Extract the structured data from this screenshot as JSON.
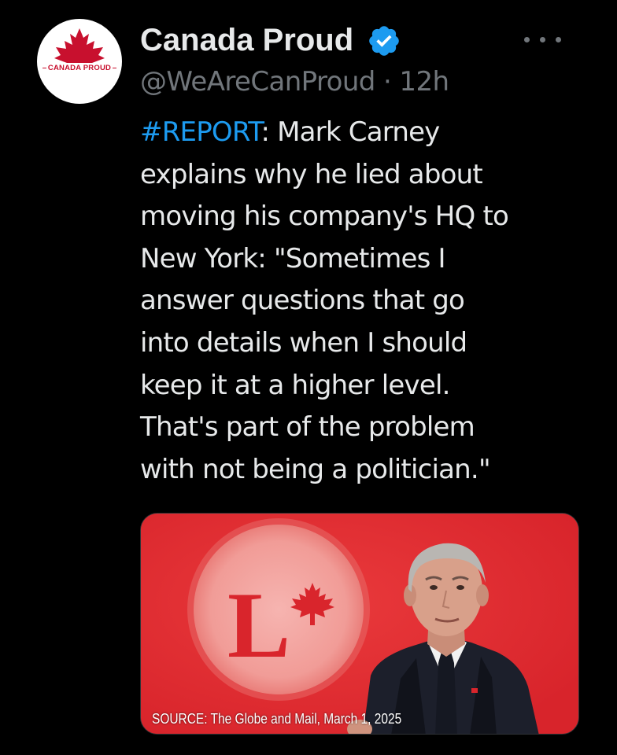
{
  "account": {
    "display_name": "Canada Proud",
    "verified": true,
    "handle": "@WeAreCanProud",
    "separator": "·",
    "time": "12h",
    "avatar_text": "CANADA PROUD",
    "avatar_icon": "maple-leaf-icon"
  },
  "tweet": {
    "hashtag": "#REPORT",
    "lines": [
      ": Mark Carney",
      "explains why he lied about",
      "moving his company's HQ to",
      "New York: \"Sometimes I",
      "answer questions that go",
      "into details when I should",
      "keep it at a higher level.",
      "That's part of the problem",
      "with not being a politician.\""
    ]
  },
  "media": {
    "caption": "SOURCE: The Globe and Mail, March 1, 2025",
    "logo_letter": "L"
  },
  "colors": {
    "background": "#000000",
    "text": "#e7e9ea",
    "secondary_text": "#71767b",
    "link": "#1d9bf0",
    "verified_badge": "#1d9bf0",
    "brand_red": "#c8102e",
    "image_red": "#e02a2f"
  }
}
